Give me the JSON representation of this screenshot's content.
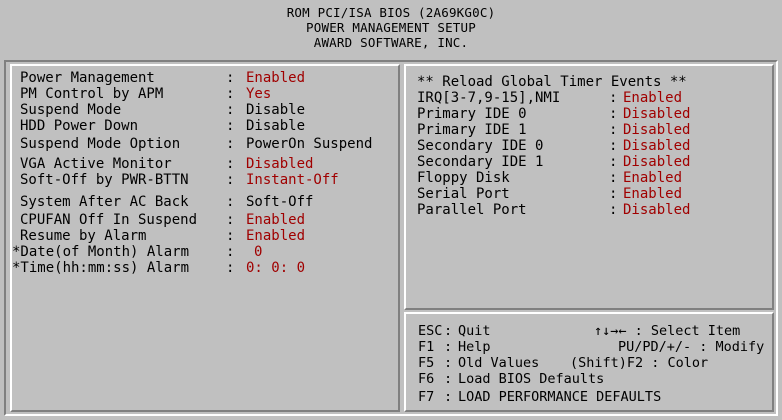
{
  "header": {
    "line1": "ROM PCI/ISA BIOS (2A69KG0C)",
    "line2": "POWER MANAGEMENT SETUP",
    "line3": "AWARD SOFTWARE, INC."
  },
  "settings": [
    {
      "label": "Power Management",
      "value": "Enabled",
      "highlight": true
    },
    {
      "label": "PM Control by APM",
      "value": "Yes",
      "highlight": true
    },
    {
      "label": "Suspend Mode",
      "value": "Disable",
      "highlight": false
    },
    {
      "label": "HDD Power Down",
      "value": "Disable",
      "highlight": false
    },
    {
      "label": "Suspend Mode Option",
      "value": "PowerOn Suspend",
      "highlight": false
    },
    {
      "label": "VGA Active Monitor",
      "value": "Disabled",
      "highlight": true
    },
    {
      "label": "Soft-Off by PWR-BTTN",
      "value": "Instant-Off",
      "highlight": true
    },
    {
      "label": "System After AC Back",
      "value": "Soft-Off",
      "highlight": false
    },
    {
      "label": "CPUFAN Off In Suspend",
      "value": "Enabled",
      "highlight": true
    },
    {
      "label": "Resume by Alarm",
      "value": "Enabled",
      "highlight": true
    },
    {
      "label": "*Date(of Month) Alarm",
      "value": "0",
      "highlight": true
    },
    {
      "label": "*Time(hh:mm:ss) Alarm",
      "value": "0: 0: 0",
      "highlight": true
    }
  ],
  "events": {
    "title": "** Reload Global Timer Events **",
    "items": [
      {
        "label": "IRQ[3-7,9-15],NMI",
        "value": "Enabled"
      },
      {
        "label": "Primary IDE 0",
        "value": "Disabled"
      },
      {
        "label": "Primary IDE 1",
        "value": "Disabled"
      },
      {
        "label": "Secondary IDE 0",
        "value": "Disabled"
      },
      {
        "label": "Secondary IDE 1",
        "value": "Disabled"
      },
      {
        "label": "Floppy Disk",
        "value": "Enabled"
      },
      {
        "label": "Serial Port",
        "value": "Enabled"
      },
      {
        "label": "Parallel Port",
        "value": "Disabled"
      }
    ]
  },
  "help": {
    "esc_key": "ESC",
    "esc_text": "Quit",
    "nav_text": "↑↓→← : Select Item",
    "f1_key": "F1",
    "f1_text": "Help",
    "modify_text": "PU/PD/+/- : Modify",
    "f5_key": "F5",
    "f5_text": "Old Values",
    "color_text": "(Shift)F2 : Color",
    "f6_key": "F6",
    "f6_text": "Load BIOS  Defaults",
    "f7_key": "F7",
    "f7_text": "LOAD PERFORMANCE DEFAULTS"
  },
  "colors": {
    "background": "#c0c0c0",
    "value_highlight": "#a00000"
  }
}
